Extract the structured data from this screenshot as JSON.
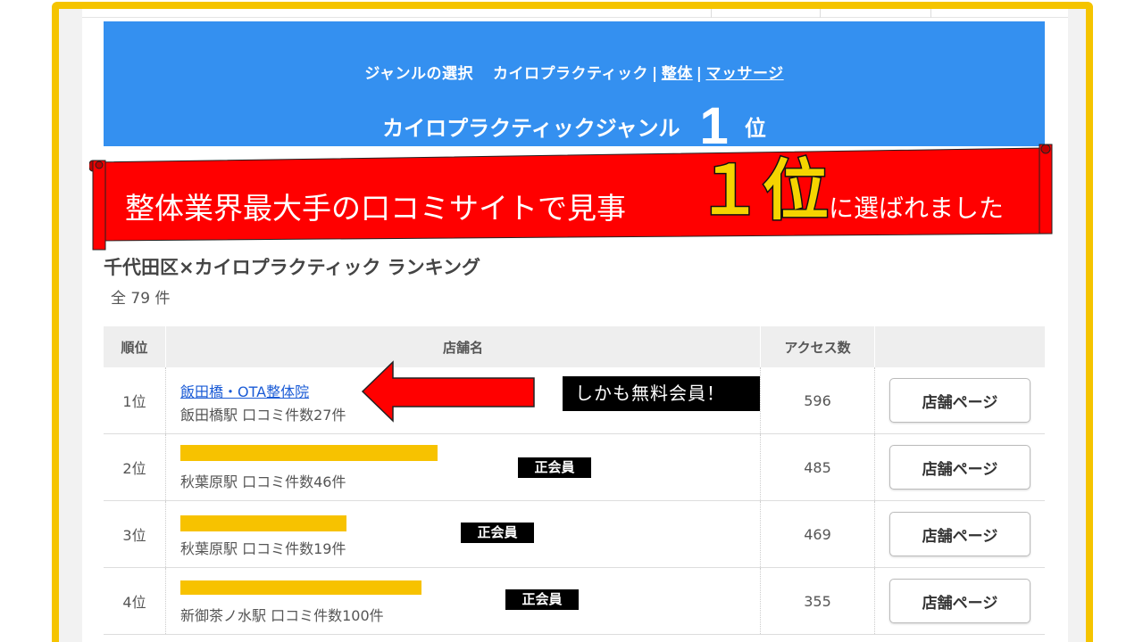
{
  "genre_bar": {
    "label": "ジャンルの選択",
    "current": "カイロプラクティック",
    "sep1": "|",
    "link1": "整体",
    "sep2": "|",
    "link2": "マッサージ"
  },
  "genre_rank": {
    "text": "カイロプラクティックジャンル",
    "number": "1",
    "unit": "位"
  },
  "scroll_banner": {
    "text": "整体業界最大手の口コミサイトで見事",
    "big": "１位",
    "tail": "に選ばれました",
    "colors": {
      "fill": "#ff0000",
      "highlight": "#f5d400"
    }
  },
  "ranking": {
    "title": "千代田区×カイロプラクティック ランキング",
    "total": "全 79 件",
    "headers": {
      "rank": "順位",
      "name": "店舗名",
      "access": "アクセス数"
    },
    "rows": [
      {
        "rank": "1位",
        "name": "飯田橋・OTA整体院",
        "sub": "飯田橋駅 口コミ件数27件",
        "access": "596",
        "button": "店舗ページ",
        "badge": ""
      },
      {
        "rank": "2位",
        "name": "",
        "sub": "秋葉原駅 口コミ件数46件",
        "access": "485",
        "button": "店舗ページ",
        "badge": "正会員"
      },
      {
        "rank": "3位",
        "name": "",
        "sub": "秋葉原駅 口コミ件数19件",
        "access": "469",
        "button": "店舗ページ",
        "badge": "正会員"
      },
      {
        "rank": "4位",
        "name": "",
        "sub": "新御茶ノ水駅 口コミ件数100件",
        "access": "355",
        "button": "店舗ページ",
        "badge": "正会員"
      }
    ]
  },
  "callout": {
    "text": "しかも無料会員！"
  },
  "colors": {
    "frame": "#f5c400",
    "banner": "#3490f0",
    "redaction": "#f7c200",
    "link": "#1a5bd6",
    "arrow": "#ff0000"
  }
}
